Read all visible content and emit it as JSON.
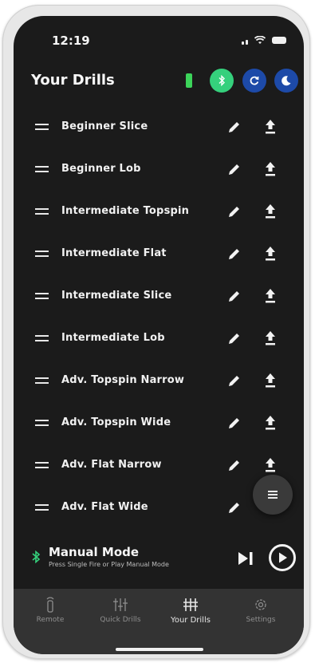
{
  "status_bar": {
    "time": "12:19"
  },
  "header": {
    "title": "Your Drills"
  },
  "drills": [
    {
      "name": "Beginner Slice"
    },
    {
      "name": "Beginner Lob"
    },
    {
      "name": "Intermediate Topspin"
    },
    {
      "name": "Intermediate Flat"
    },
    {
      "name": "Intermediate Slice"
    },
    {
      "name": "Intermediate Lob"
    },
    {
      "name": "Adv. Topspin Narrow"
    },
    {
      "name": "Adv. Topspin Wide"
    },
    {
      "name": "Adv. Flat Narrow"
    },
    {
      "name": "Adv. Flat Wide"
    }
  ],
  "manual_mode": {
    "title": "Manual Mode",
    "subtitle": "Press Single Fire or Play Manual Mode"
  },
  "tabs": [
    {
      "label": "Remote",
      "icon": "remote-icon"
    },
    {
      "label": "Quick Drills",
      "icon": "quick-drills-icon"
    },
    {
      "label": "Your Drills",
      "icon": "your-drills-icon",
      "active": true
    },
    {
      "label": "Settings",
      "icon": "gear-icon"
    }
  ],
  "colors": {
    "background": "#1b1b1b",
    "bluetooth_green": "#35d07c",
    "battery_green": "#3cd45a",
    "button_blue": "#1d4aa8",
    "tab_bar": "#333333"
  }
}
